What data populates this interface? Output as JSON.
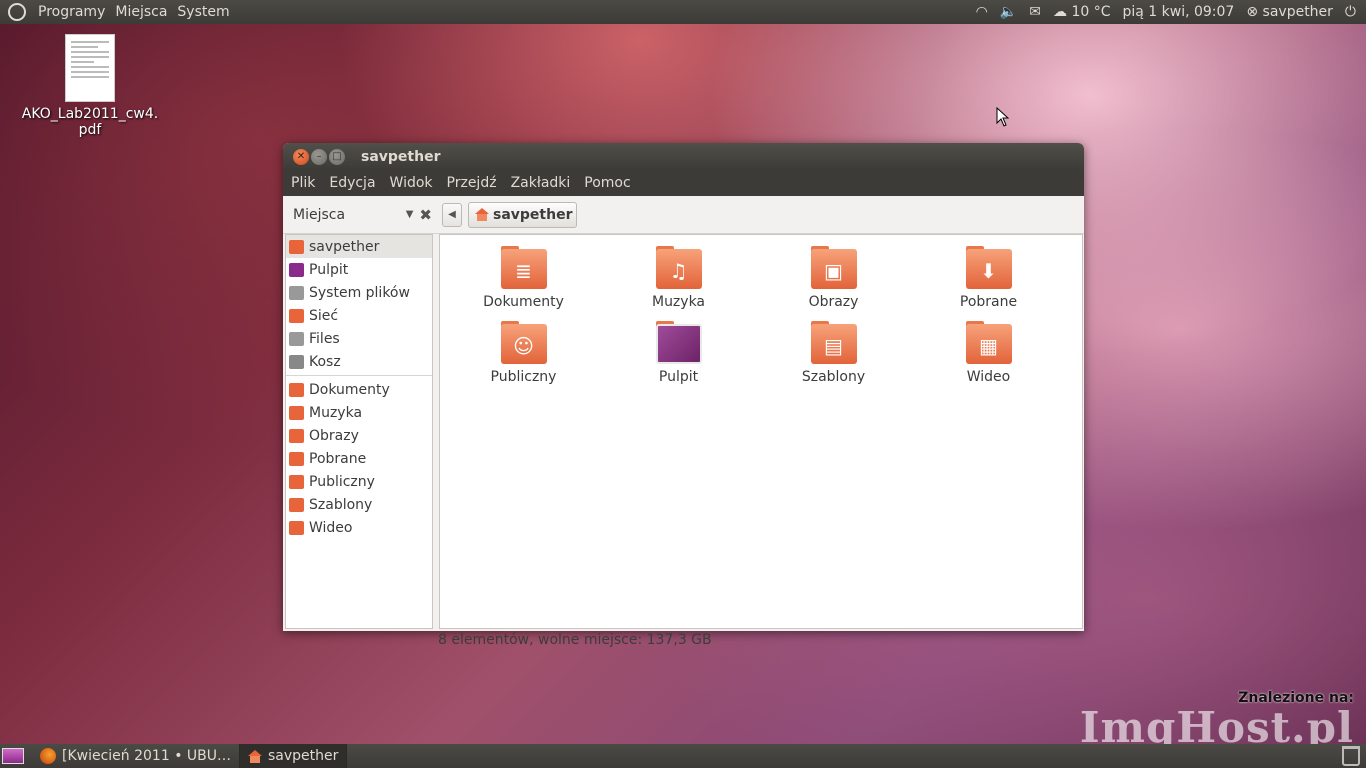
{
  "top_panel": {
    "menus": [
      "Programy",
      "Miejsca",
      "System"
    ],
    "weather": "10 °C",
    "datetime": "pią 1 kwi, 09:07",
    "user": "savpether"
  },
  "desktop": {
    "file_icon": {
      "label_line1": "AKO_Lab2011_cw4.",
      "label_line2": "pdf"
    }
  },
  "window": {
    "title": "savpether",
    "menubar": [
      "Plik",
      "Edycja",
      "Widok",
      "Przejdź",
      "Zakładki",
      "Pomoc"
    ],
    "places_label": "Miejsca",
    "breadcrumb": "savpether",
    "sidebar_places": [
      {
        "label": "savpether",
        "icon": "home-icon",
        "color": "#e8643a"
      },
      {
        "label": "Pulpit",
        "icon": "desktop-icon",
        "color": "#8a2a8a"
      },
      {
        "label": "System plików",
        "icon": "drive-icon",
        "color": "#999999"
      },
      {
        "label": "Sieć",
        "icon": "network-icon",
        "color": "#e8643a"
      },
      {
        "label": "Files",
        "icon": "drive-icon",
        "color": "#999999"
      },
      {
        "label": "Kosz",
        "icon": "trash-icon",
        "color": "#888888"
      }
    ],
    "sidebar_bookmarks": [
      {
        "label": "Dokumenty",
        "icon": "folder-documents-icon",
        "color": "#e8643a"
      },
      {
        "label": "Muzyka",
        "icon": "folder-music-icon",
        "color": "#e8643a"
      },
      {
        "label": "Obrazy",
        "icon": "folder-pictures-icon",
        "color": "#e8643a"
      },
      {
        "label": "Pobrane",
        "icon": "folder-download-icon",
        "color": "#e8643a"
      },
      {
        "label": "Publiczny",
        "icon": "folder-public-icon",
        "color": "#e8643a"
      },
      {
        "label": "Szablony",
        "icon": "folder-templates-icon",
        "color": "#e8643a"
      },
      {
        "label": "Wideo",
        "icon": "folder-video-icon",
        "color": "#e8643a"
      }
    ],
    "folders": [
      {
        "label": "Dokumenty",
        "emblem": "≣",
        "icon": "folder-documents-icon"
      },
      {
        "label": "Muzyka",
        "emblem": "♫",
        "icon": "folder-music-icon"
      },
      {
        "label": "Obrazy",
        "emblem": "▣",
        "icon": "folder-pictures-icon"
      },
      {
        "label": "Pobrane",
        "emblem": "⬇",
        "icon": "folder-download-icon"
      },
      {
        "label": "Publiczny",
        "emblem": "☺",
        "icon": "folder-public-icon"
      },
      {
        "label": "Pulpit",
        "emblem": "",
        "icon": "folder-desktop-icon"
      },
      {
        "label": "Szablony",
        "emblem": "▤",
        "icon": "folder-templates-icon"
      },
      {
        "label": "Wideo",
        "emblem": "▦",
        "icon": "folder-video-icon"
      }
    ],
    "status": "8 elementów, wolne miejsce: 137,3 GB"
  },
  "bottom_panel": {
    "tasks": [
      "[Kwiecień 2011 • UBU…",
      "savpether"
    ]
  },
  "watermark": {
    "small": "Znalezione na:",
    "big": "ImgHost.pl"
  }
}
